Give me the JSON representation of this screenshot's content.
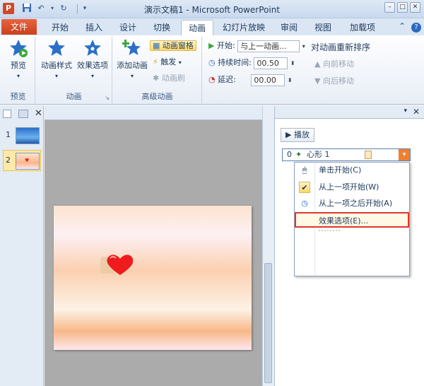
{
  "window": {
    "title": "演示文稿1  -  Microsoft PowerPoint",
    "app_letter": "P",
    "accent_color": "#d24726"
  },
  "tabs": {
    "file": "文件",
    "items": [
      "开始",
      "插入",
      "设计",
      "切换",
      "动画",
      "幻灯片放映",
      "审阅",
      "视图",
      "加载项"
    ],
    "active": "动画"
  },
  "ribbon": {
    "preview": {
      "button": "预览",
      "group": "预览"
    },
    "animation": {
      "style_button": "动画样式",
      "effect_button": "效果选项",
      "group": "动画"
    },
    "advanced": {
      "add_button": "添加动画",
      "pane_button": "动画窗格",
      "trigger_button": "触发",
      "painter_button": "动画刷",
      "group": "高级动画"
    },
    "timing": {
      "start_label": "开始:",
      "start_value": "与上一动画...",
      "duration_label": "持续时间:",
      "duration_value": "00.50",
      "delay_label": "延迟:",
      "delay_value": "00.00",
      "reorder_title": "对动画重新排序",
      "move_earlier": "向前移动",
      "move_later": "向后移动"
    }
  },
  "slides": {
    "thumbs": [
      {
        "number": "1"
      },
      {
        "number": "2"
      }
    ]
  },
  "anim_pane": {
    "play": "播放",
    "item": {
      "index": "0",
      "name": "心形 1"
    },
    "menu": [
      {
        "label": "单击开始(C)",
        "icon": "mouse-icon"
      },
      {
        "label": "从上一项开始(W)",
        "icon": "check-icon",
        "checked": true
      },
      {
        "label": "从上一项之后开始(A)",
        "icon": "clock-icon"
      },
      {
        "label": "效果选项(E)...",
        "icon": "",
        "focused": true
      }
    ]
  }
}
